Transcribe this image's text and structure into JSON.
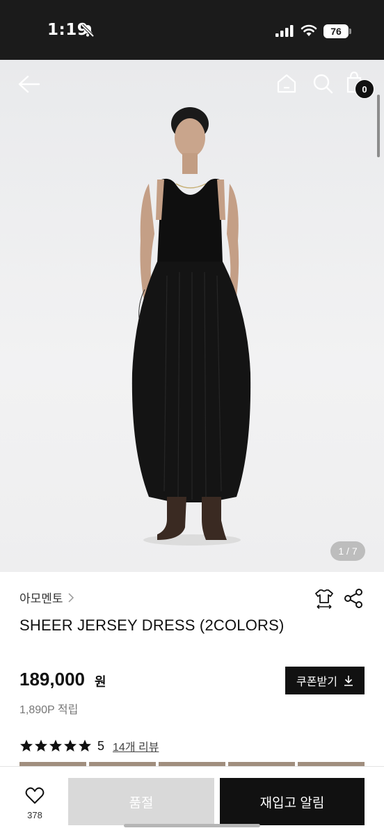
{
  "status_bar": {
    "time": "1:19",
    "battery": "76"
  },
  "header": {
    "cart_count": "0"
  },
  "hero": {
    "image_counter": "1 / 7"
  },
  "product": {
    "brand": "아모멘토",
    "title": "SHEER JERSEY DRESS (2COLORS)",
    "price": "189,000",
    "price_unit": "원",
    "points": "1,890P 적립",
    "coupon_label": "쿠폰받기",
    "rating_value": "5",
    "rating_stars": 5,
    "review_link": "14개 리뷰"
  },
  "bottom_bar": {
    "like_count": "378",
    "soldout_label": "품절",
    "restock_label": "재입고 알림"
  },
  "colors": {
    "status_bar_bg": "#1b1b1b",
    "primary_dark": "#111111",
    "disabled_gray": "#d9d9d9"
  }
}
